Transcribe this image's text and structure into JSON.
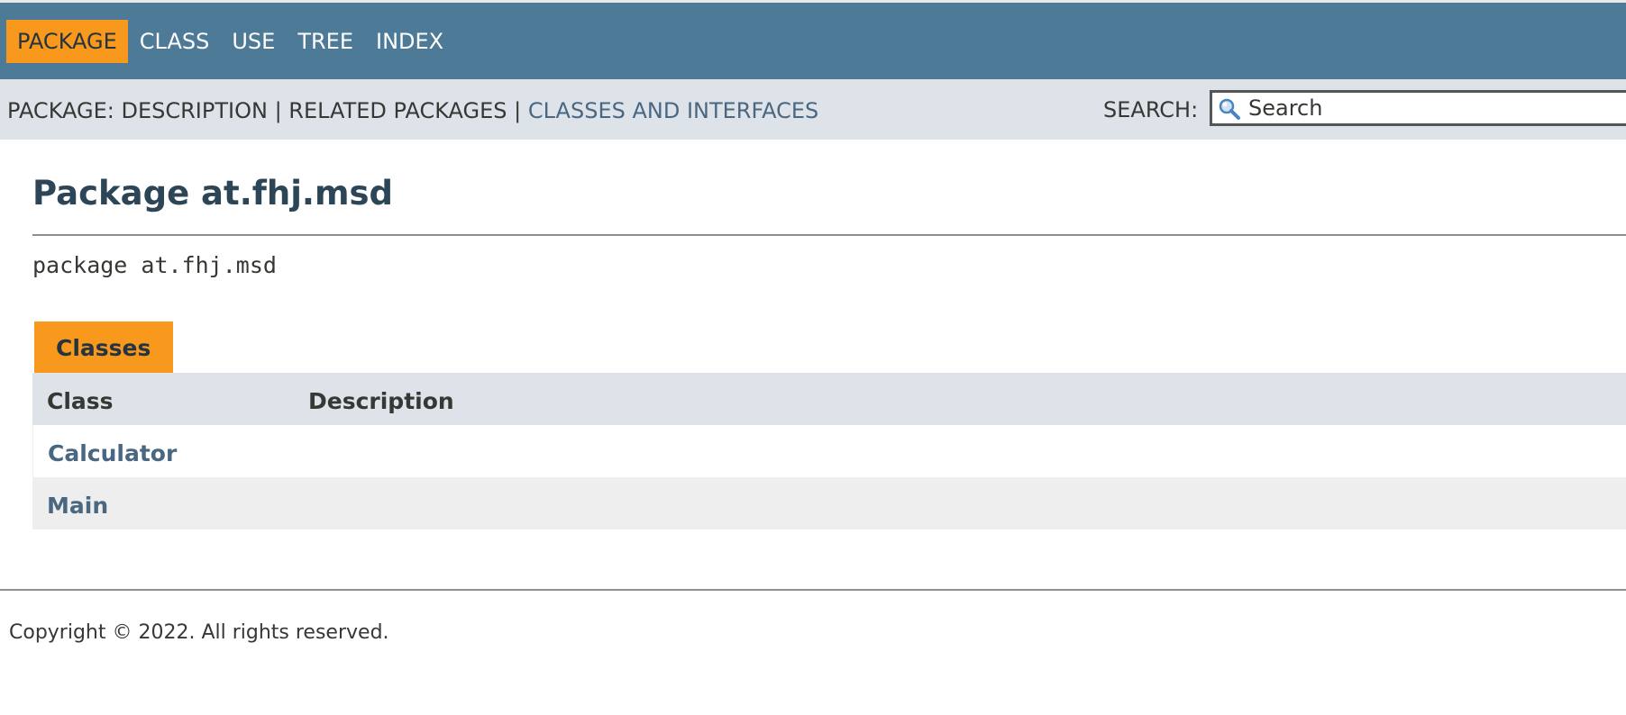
{
  "nav": {
    "items": [
      {
        "label": "PACKAGE",
        "active": true
      },
      {
        "label": "CLASS",
        "active": false
      },
      {
        "label": "USE",
        "active": false
      },
      {
        "label": "TREE",
        "active": false
      },
      {
        "label": "INDEX",
        "active": false
      }
    ]
  },
  "subnav": {
    "prefix": "PACKAGE: ",
    "description": "DESCRIPTION",
    "separator": " | ",
    "related": "RELATED PACKAGES",
    "classes_link": "CLASSES AND INTERFACES"
  },
  "search": {
    "label": "SEARCH:",
    "placeholder": "Search",
    "value": ""
  },
  "main": {
    "title": "Package at.fhj.msd",
    "declaration": "package at.fhj.msd"
  },
  "classes_table": {
    "caption": "Classes",
    "headers": [
      "Class",
      "Description"
    ],
    "rows": [
      {
        "name": "Calculator",
        "description": ""
      },
      {
        "name": "Main",
        "description": ""
      }
    ]
  },
  "footer": {
    "copyright": "Copyright © 2022. All rights reserved."
  },
  "colors": {
    "nav_bg": "#4d7a97",
    "accent": "#f8981d",
    "subnav_bg": "#dee3e9",
    "link": "#4a6782"
  }
}
